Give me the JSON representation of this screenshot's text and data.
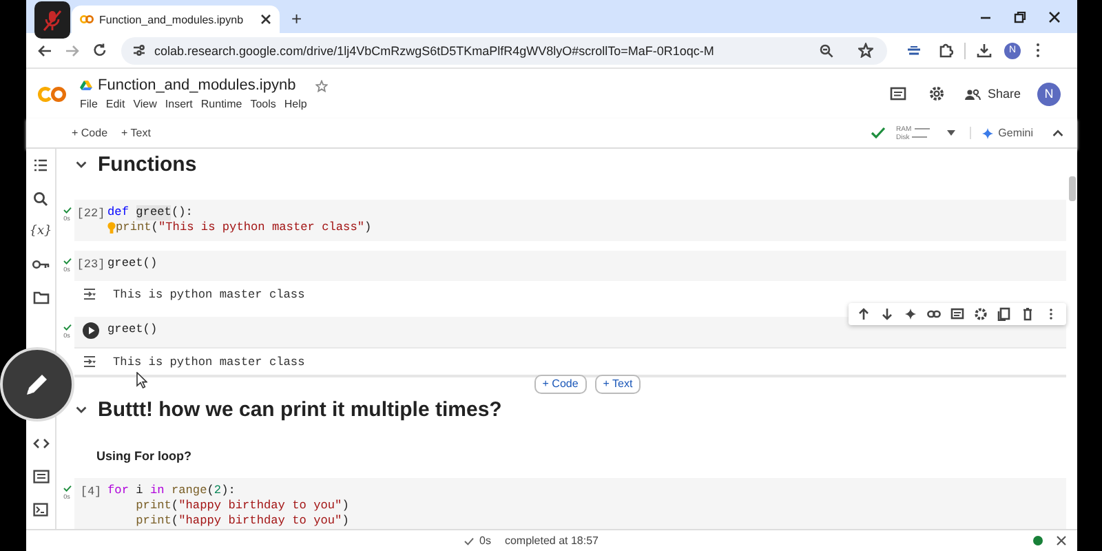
{
  "browser": {
    "tab": {
      "title": "Function_and_modules.ipynb",
      "selected": true
    },
    "new_tab": "+",
    "url": "colab.research.google.com/drive/1lj4VbCmRzwgS6tD5TKmaPlfR4gWV8lyO#scrollTo=MaF-0R1oqc-M",
    "profile_initial": "N"
  },
  "notebook": {
    "title": "Function_and_modules.ipynb",
    "menu": [
      "File",
      "Edit",
      "View",
      "Insert",
      "Runtime",
      "Tools",
      "Help"
    ],
    "share": "Share",
    "avatar_initial": "N"
  },
  "toolbar": {
    "add_code": "+ Code",
    "add_text": "+ Text",
    "connected": true,
    "ram_label": "RAM",
    "disk_label": "Disk",
    "gemini": "Gemini"
  },
  "sidebar": [
    {
      "kind": "toc"
    },
    {
      "kind": "search"
    },
    {
      "kind": "variables",
      "glyph": "{x}"
    },
    {
      "kind": "secrets"
    },
    {
      "kind": "files"
    },
    {
      "kind": "snippets"
    },
    {
      "kind": "palette"
    },
    {
      "kind": "terminal"
    }
  ],
  "cells": [
    {
      "kind": "heading",
      "text": "Functions",
      "expanded": true
    },
    {
      "kind": "code",
      "count": "[22]",
      "executed": true,
      "time": "0s",
      "focused": false,
      "lines": [
        {
          "tokens": [
            {
              "text": "def ",
              "kind": "keyword"
            },
            {
              "text": "greet",
              "kind": "highlight"
            },
            {
              "text": "():",
              "kind": "plain"
            }
          ]
        },
        {
          "hint": true,
          "tokens": [
            {
              "text": "print",
              "kind": "func"
            },
            {
              "text": "(",
              "kind": "plain"
            },
            {
              "text": "\"This is python master class\"",
              "kind": "string"
            },
            {
              "text": ")",
              "kind": "plain"
            }
          ]
        }
      ]
    },
    {
      "kind": "code",
      "count": "[23]",
      "executed": true,
      "time": "0s",
      "focused": false,
      "lines": [
        {
          "tokens": [
            {
              "text": "greet",
              "kind": "plain"
            },
            {
              "text": "()",
              "kind": "plain"
            }
          ]
        }
      ],
      "output": "This is python master class"
    },
    {
      "kind": "code",
      "executed": true,
      "time": "0s",
      "focused": true,
      "lines": [
        {
          "tokens": [
            {
              "text": "greet",
              "kind": "plain"
            },
            {
              "text": "()",
              "kind": "plain"
            }
          ]
        }
      ],
      "output": "This is python master class"
    },
    {
      "kind": "insert",
      "code": "+ Code",
      "text": "+ Text"
    },
    {
      "kind": "heading",
      "text": "Buttt! how we can print it multiple times?",
      "expanded": true
    },
    {
      "kind": "subheading",
      "text": "Using For loop?"
    },
    {
      "kind": "code",
      "count": "[4]",
      "executed": true,
      "time": "0s",
      "focused": false,
      "lines": [
        {
          "tokens": [
            {
              "text": "for",
              "kind": "control"
            },
            {
              "text": " i ",
              "kind": "plain"
            },
            {
              "text": "in ",
              "kind": "control"
            },
            {
              "text": "range",
              "kind": "func"
            },
            {
              "text": "(",
              "kind": "plain"
            },
            {
              "text": "2",
              "kind": "number"
            },
            {
              "text": "):",
              "kind": "plain"
            }
          ]
        },
        {
          "tokens": [
            {
              "text": "    print",
              "kind": "func"
            },
            {
              "text": "(",
              "kind": "plain"
            },
            {
              "text": "\"happy birthday to you\"",
              "kind": "string"
            },
            {
              "text": ")",
              "kind": "plain"
            }
          ]
        },
        {
          "tokens": [
            {
              "text": "    print",
              "kind": "func"
            },
            {
              "text": "(",
              "kind": "plain"
            },
            {
              "text": "\"happy birthday to you\"",
              "kind": "string"
            },
            {
              "text": ")",
              "kind": "plain"
            }
          ]
        }
      ]
    }
  ],
  "status_bar": {
    "done": true,
    "elapsed": "0s",
    "message": "completed at 18:57"
  }
}
